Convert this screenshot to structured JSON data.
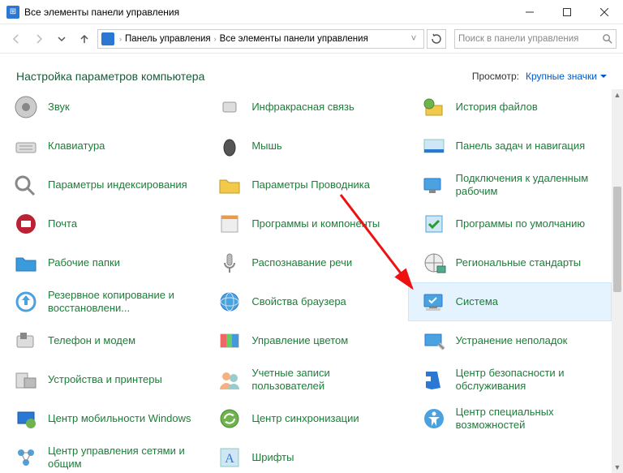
{
  "window": {
    "title": "Все элементы панели управления"
  },
  "breadcrumb": {
    "seg1": "Панель управления",
    "seg2": "Все элементы панели управления"
  },
  "search": {
    "placeholder": "Поиск в панели управления"
  },
  "header": {
    "title": "Настройка параметров компьютера",
    "view_label": "Просмотр:",
    "view_value": "Крупные значки"
  },
  "items": [
    {
      "label": "Звук",
      "icon": "speaker"
    },
    {
      "label": "Инфракрасная связь",
      "icon": "ir"
    },
    {
      "label": "История файлов",
      "icon": "history"
    },
    {
      "label": "Клавиатура",
      "icon": "keyboard"
    },
    {
      "label": "Мышь",
      "icon": "mouse"
    },
    {
      "label": "Панель задач и навигация",
      "icon": "taskbar"
    },
    {
      "label": "Параметры индексирования",
      "icon": "indexing"
    },
    {
      "label": "Параметры Проводника",
      "icon": "folder"
    },
    {
      "label": "Подключения к удаленным рабочим",
      "icon": "remote"
    },
    {
      "label": "Почта",
      "icon": "mail"
    },
    {
      "label": "Программы и компоненты",
      "icon": "programs"
    },
    {
      "label": "Программы по умолчанию",
      "icon": "defaults"
    },
    {
      "label": "Рабочие папки",
      "icon": "workfolders"
    },
    {
      "label": "Распознавание речи",
      "icon": "speech"
    },
    {
      "label": "Региональные стандарты",
      "icon": "region"
    },
    {
      "label": "Резервное копирование и восстановлени...",
      "icon": "backup"
    },
    {
      "label": "Свойства браузера",
      "icon": "internet"
    },
    {
      "label": "Система",
      "icon": "system",
      "highlight": true
    },
    {
      "label": "Телефон и модем",
      "icon": "phone"
    },
    {
      "label": "Управление цветом",
      "icon": "color"
    },
    {
      "label": "Устранение неполадок",
      "icon": "troubleshoot"
    },
    {
      "label": "Устройства и принтеры",
      "icon": "devices"
    },
    {
      "label": "Учетные записи пользователей",
      "icon": "users"
    },
    {
      "label": "Центр безопасности и обслуживания",
      "icon": "security"
    },
    {
      "label": "Центр мобильности Windows",
      "icon": "mobility"
    },
    {
      "label": "Центр синхронизации",
      "icon": "sync"
    },
    {
      "label": "Центр специальных возможностей",
      "icon": "ease"
    },
    {
      "label": "Центр управления сетями и общим",
      "icon": "network"
    },
    {
      "label": "Шрифты",
      "icon": "fonts"
    },
    {
      "label": "",
      "icon": ""
    }
  ]
}
